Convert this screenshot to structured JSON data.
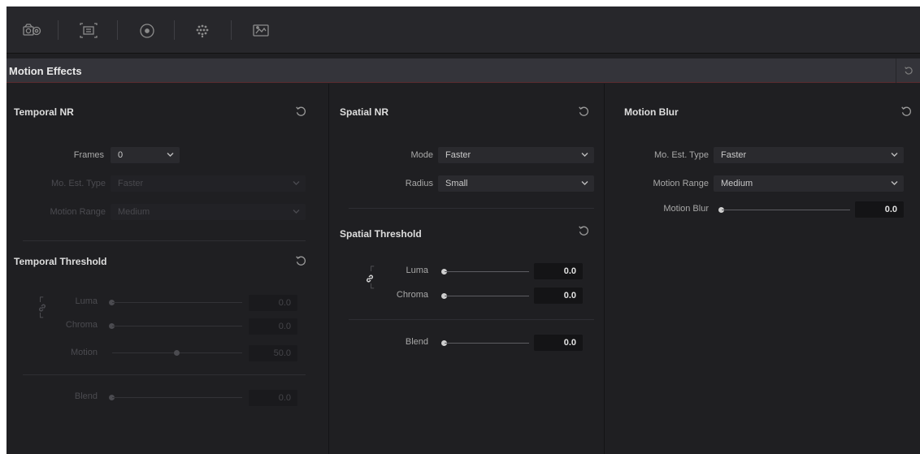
{
  "toolbar": {
    "icons": [
      "camera-raw-icon",
      "sizing-icon",
      "motion-effects-icon",
      "blur-icon",
      "keyframes-icon"
    ]
  },
  "header": {
    "title": "Motion Effects",
    "reset_icon": "reset-icon"
  },
  "temporal_nr": {
    "title": "Temporal NR",
    "frames_label": "Frames",
    "frames_value": "0",
    "mo_est_label": "Mo. Est. Type",
    "mo_est_value": "Faster",
    "motion_range_label": "Motion Range",
    "motion_range_value": "Medium"
  },
  "temporal_threshold": {
    "title": "Temporal Threshold",
    "luma_label": "Luma",
    "luma_value": "0.0",
    "chroma_label": "Chroma",
    "chroma_value": "0.0",
    "motion_label": "Motion",
    "motion_value": "50.0",
    "motion_level": 0.5,
    "blend_label": "Blend",
    "blend_value": "0.0"
  },
  "spatial_nr": {
    "title": "Spatial NR",
    "mode_label": "Mode",
    "mode_value": "Faster",
    "radius_label": "Radius",
    "radius_value": "Small"
  },
  "spatial_threshold": {
    "title": "Spatial Threshold",
    "luma_label": "Luma",
    "luma_value": "0.0",
    "chroma_label": "Chroma",
    "chroma_value": "0.0",
    "blend_label": "Blend",
    "blend_value": "0.0"
  },
  "motion_blur": {
    "title": "Motion Blur",
    "mo_est_label": "Mo. Est. Type",
    "mo_est_value": "Faster",
    "motion_range_label": "Motion Range",
    "motion_range_value": "Medium",
    "motion_blur_label": "Motion Blur",
    "motion_blur_value": "0.0"
  }
}
